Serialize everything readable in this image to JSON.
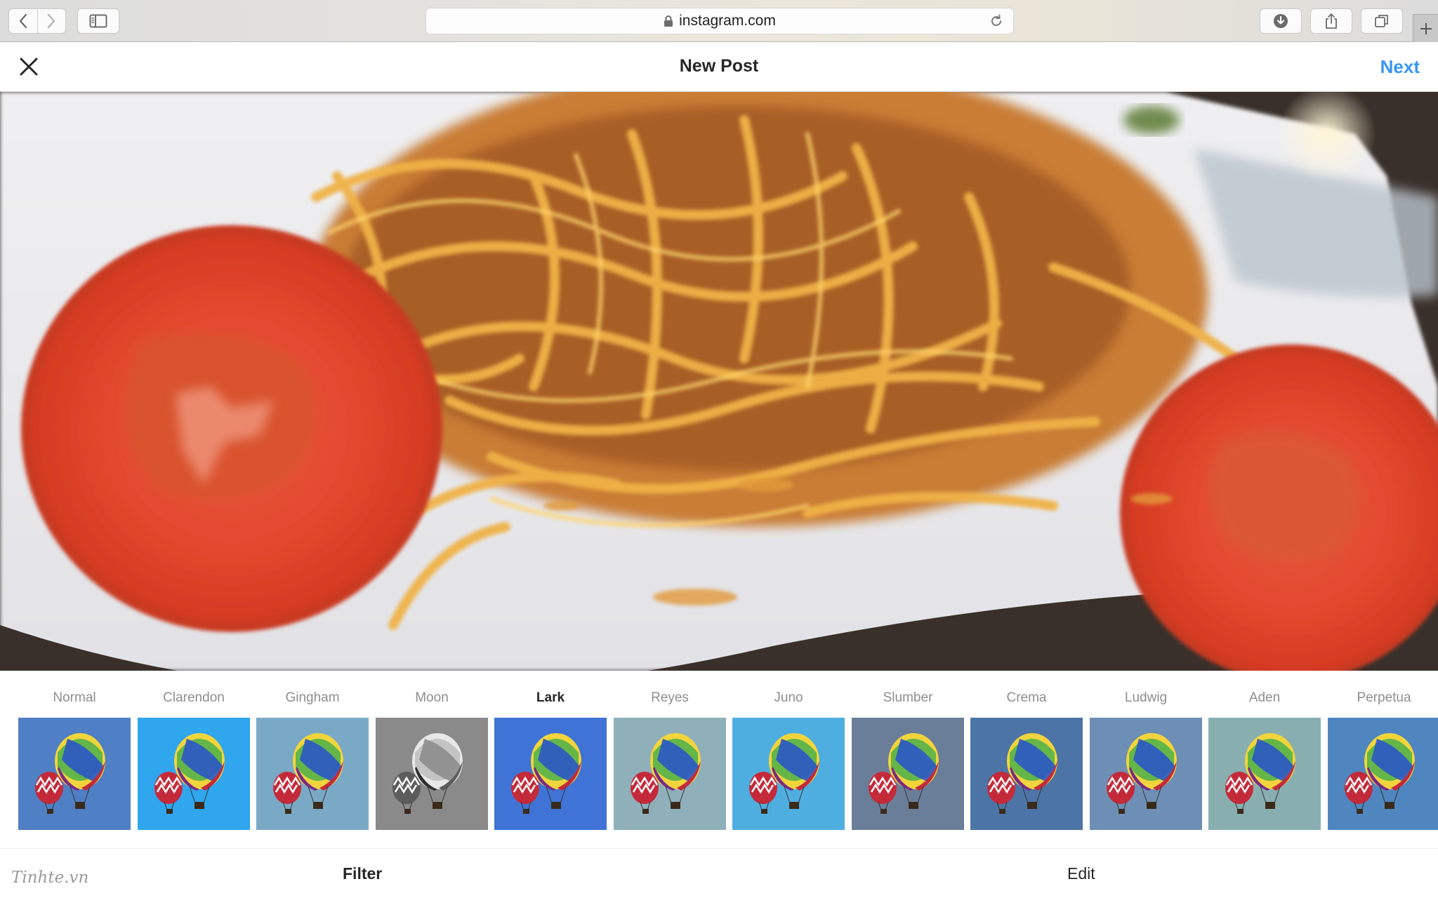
{
  "browser": {
    "url": "instagram.com"
  },
  "header": {
    "title": "New Post",
    "next_label": "Next"
  },
  "filters": [
    {
      "name": "Normal",
      "bg": "#4f7fc4",
      "selected": false
    },
    {
      "name": "Clarendon",
      "bg": "#2fa6ee",
      "selected": false
    },
    {
      "name": "Gingham",
      "bg": "#7aa9c6",
      "selected": false
    },
    {
      "name": "Moon",
      "bg": "#8a8a8a",
      "selected": false
    },
    {
      "name": "Lark",
      "bg": "#3f74d6",
      "selected": true
    },
    {
      "name": "Reyes",
      "bg": "#8fb0ba",
      "selected": false
    },
    {
      "name": "Juno",
      "bg": "#4faee0",
      "selected": false
    },
    {
      "name": "Slumber",
      "bg": "#6b7e99",
      "selected": false
    },
    {
      "name": "Crema",
      "bg": "#4c74a6",
      "selected": false
    },
    {
      "name": "Ludwig",
      "bg": "#6e8fb5",
      "selected": false
    },
    {
      "name": "Aden",
      "bg": "#88aeb0",
      "selected": false
    },
    {
      "name": "Perpetua",
      "bg": "#4f86c0",
      "selected": false
    }
  ],
  "bottom_tabs": {
    "filter_label": "Filter",
    "edit_label": "Edit"
  },
  "watermark": "Tinhte.vn"
}
